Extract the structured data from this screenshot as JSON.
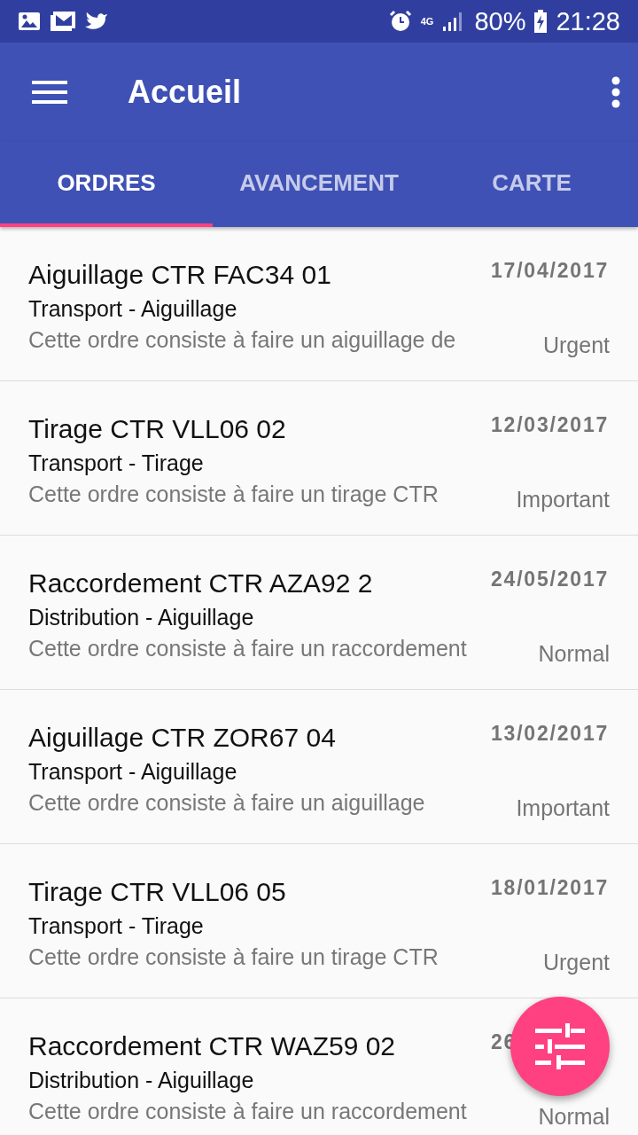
{
  "status_bar": {
    "battery": "80%",
    "time": "21:28",
    "network": "4G"
  },
  "app_bar": {
    "title": "Accueil"
  },
  "tabs": [
    {
      "label": "ORDRES",
      "selected": true
    },
    {
      "label": "AVANCEMENT",
      "selected": false
    },
    {
      "label": "CARTE",
      "selected": false
    }
  ],
  "orders": [
    {
      "title": "Aiguillage CTR FAC34 01",
      "category": "Transport - Aiguillage",
      "description": "Cette ordre consiste à faire un aiguillage de",
      "date": "17/04/2017",
      "priority": "Urgent"
    },
    {
      "title": "Tirage CTR VLL06 02",
      "category": "Transport - Tirage",
      "description": "Cette ordre consiste à faire un tirage CTR",
      "date": "12/03/2017",
      "priority": "Important"
    },
    {
      "title": "Raccordement CTR AZA92 2",
      "category": "Distribution - Aiguillage",
      "description": "Cette ordre consiste à faire un raccordement",
      "date": "24/05/2017",
      "priority": "Normal"
    },
    {
      "title": "Aiguillage CTR ZOR67 04",
      "category": "Transport - Aiguillage",
      "description": "Cette ordre consiste à faire un aiguillage",
      "date": "13/02/2017",
      "priority": "Important"
    },
    {
      "title": "Tirage CTR VLL06 05",
      "category": "Transport - Tirage",
      "description": "Cette ordre consiste à faire un tirage CTR",
      "date": "18/01/2017",
      "priority": "Urgent"
    },
    {
      "title": "Raccordement CTR WAZ59 02",
      "category": "Distribution - Aiguillage",
      "description": "Cette ordre consiste à faire un raccordement",
      "date": "26",
      "priority": "Normal"
    }
  ]
}
